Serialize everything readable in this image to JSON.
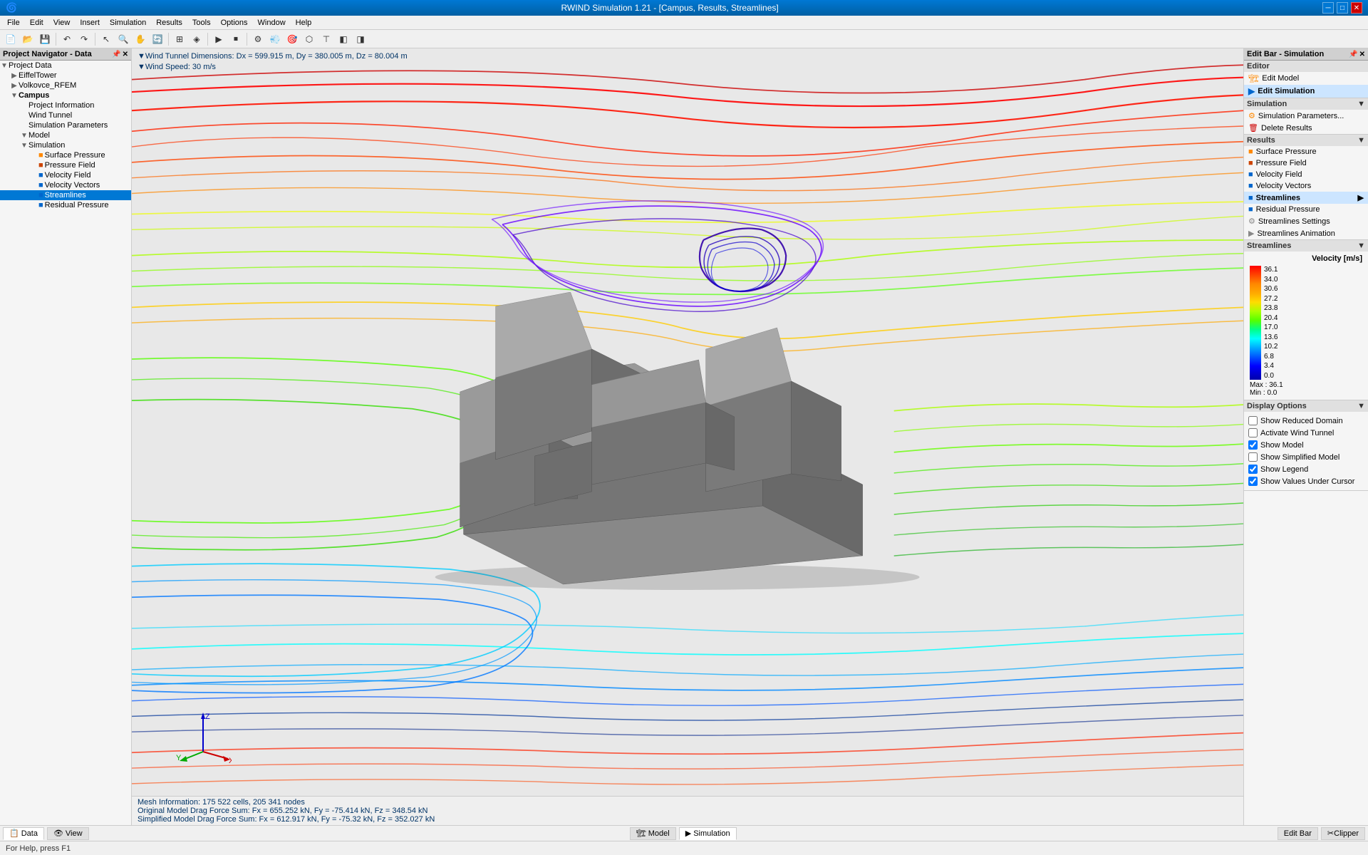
{
  "window": {
    "title": "RWIND Simulation 1.21 - [Campus, Results, Streamlines]"
  },
  "menu": {
    "items": [
      "File",
      "Edit",
      "View",
      "Insert",
      "Simulation",
      "Results",
      "Tools",
      "Options",
      "Window",
      "Help"
    ]
  },
  "left_panel": {
    "header": "Project Navigator - Data",
    "tree": [
      {
        "id": "project-data",
        "label": "Project Data",
        "level": 0,
        "expanded": true,
        "icon": "📁"
      },
      {
        "id": "eiffel",
        "label": "EiffelTower",
        "level": 1,
        "expanded": false,
        "icon": "📁"
      },
      {
        "id": "volkovce",
        "label": "Volkovce_RFEM",
        "level": 1,
        "expanded": false,
        "icon": "📁"
      },
      {
        "id": "campus",
        "label": "Campus",
        "level": 1,
        "expanded": true,
        "icon": "📁",
        "bold": true
      },
      {
        "id": "project-info",
        "label": "Project Information",
        "level": 2,
        "icon": "📄"
      },
      {
        "id": "wind-tunnel",
        "label": "Wind Tunnel",
        "level": 2,
        "icon": "💨"
      },
      {
        "id": "sim-params",
        "label": "Simulation Parameters",
        "level": 2,
        "icon": "⚙"
      },
      {
        "id": "model",
        "label": "Model",
        "level": 2,
        "expanded": true,
        "icon": "🏗"
      },
      {
        "id": "simulation",
        "label": "Simulation",
        "level": 2,
        "expanded": true,
        "icon": "▶"
      },
      {
        "id": "surface-pressure",
        "label": "Surface Pressure",
        "level": 3,
        "icon": "🎨"
      },
      {
        "id": "pressure-field",
        "label": "Pressure Field",
        "level": 3,
        "icon": "🎨"
      },
      {
        "id": "velocity-field",
        "label": "Velocity Field",
        "level": 3,
        "icon": "🎨"
      },
      {
        "id": "velocity-vectors",
        "label": "Velocity Vectors",
        "level": 3,
        "icon": "🎨"
      },
      {
        "id": "streamlines",
        "label": "Streamlines",
        "level": 3,
        "icon": "🎨",
        "selected": true
      },
      {
        "id": "residual-pressure",
        "label": "Residual Pressure",
        "level": 3,
        "icon": "🎨"
      }
    ]
  },
  "viewport": {
    "info_line1": "▼Wind Tunnel Dimensions: Dx = 599.915 m, Dy = 380.005 m, Dz = 80.004 m",
    "info_line2": "▼Wind Speed: 30 m/s"
  },
  "status_info": {
    "line1": "Mesh Information: 175 522 cells, 205 341 nodes",
    "line2": "Original Model Drag Force Sum: Fx = 655.252 kN, Fy = -75.414 kN, Fz = 348.54 kN",
    "line3": "Simplified Model Drag Force Sum: Fx = 612.917 kN, Fy = -75.32 kN, Fz = 352.027 kN"
  },
  "right_panel": {
    "header": "Edit Bar - Simulation",
    "editor_section": {
      "title": "Editor",
      "items": [
        "Edit Model",
        "Edit Simulation"
      ]
    },
    "simulation_section": {
      "title": "Simulation",
      "items": [
        "Simulation Parameters...",
        "Delete Results"
      ]
    },
    "results_section": {
      "title": "Results",
      "items": [
        "Surface Pressure",
        "Pressure Field",
        "Velocity Field",
        "Velocity Vectors",
        "Streamlines",
        "Residual Pressure",
        "Streamlines Settings",
        "Streamlines Animation"
      ]
    },
    "legend": {
      "title": "Streamlines",
      "subtitle": "Velocity [m/s]",
      "values": [
        "36.1",
        "34.0",
        "30.6",
        "27.2",
        "23.8",
        "20.4",
        "17.0",
        "13.6",
        "10.2",
        "6.8",
        "3.4",
        "0.0"
      ],
      "max_label": "Max",
      "max_value": "36.1",
      "min_label": "Min",
      "min_value": "0.0"
    },
    "display_options": {
      "title": "Display Options",
      "options": [
        {
          "id": "show-reduced",
          "label": "Show Reduced Domain",
          "checked": false
        },
        {
          "id": "activate-wind",
          "label": "Activate Wind Tunnel",
          "checked": false
        },
        {
          "id": "show-model",
          "label": "Show Model",
          "checked": true
        },
        {
          "id": "show-simplified",
          "label": "Show Simplified Model",
          "checked": false
        },
        {
          "id": "show-legend",
          "label": "Show Legend",
          "checked": true
        },
        {
          "id": "show-values",
          "label": "Show Values Under Cursor",
          "checked": true
        }
      ]
    }
  },
  "bottom": {
    "tabs": [
      {
        "id": "data-tab",
        "label": "Data"
      },
      {
        "id": "view-tab",
        "label": "View"
      }
    ],
    "right_buttons": [
      "Edit Bar",
      "Clipper"
    ]
  },
  "status_bar": {
    "help_text": "For Help, press F1"
  }
}
